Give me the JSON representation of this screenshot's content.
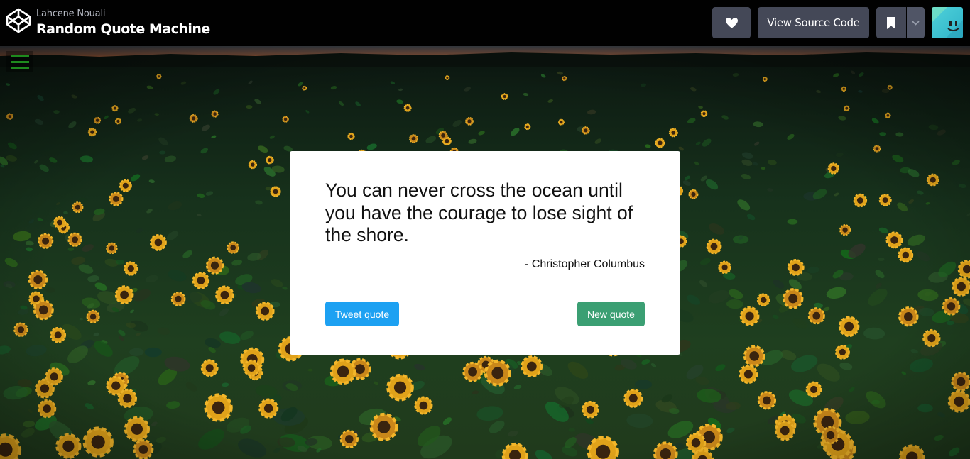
{
  "header": {
    "author": "Lahcene Nouali",
    "title": "Random Quote Machine",
    "heart_icon": "heart-icon",
    "view_source_label": "View Source Code",
    "bookmark_icon": "bookmark-icon",
    "caret_icon": "chevron-down-icon"
  },
  "quote": {
    "text": "You can never cross the ocean until you have the courage to lose sight of the shore.",
    "author": "- Christopher Columbus"
  },
  "actions": {
    "tweet_label": "Tweet quote",
    "new_label": "New quote"
  },
  "colors": {
    "tweet": "#1da1f2",
    "new_quote": "#3b9f73",
    "menu_icon": "#1e8a1e"
  }
}
